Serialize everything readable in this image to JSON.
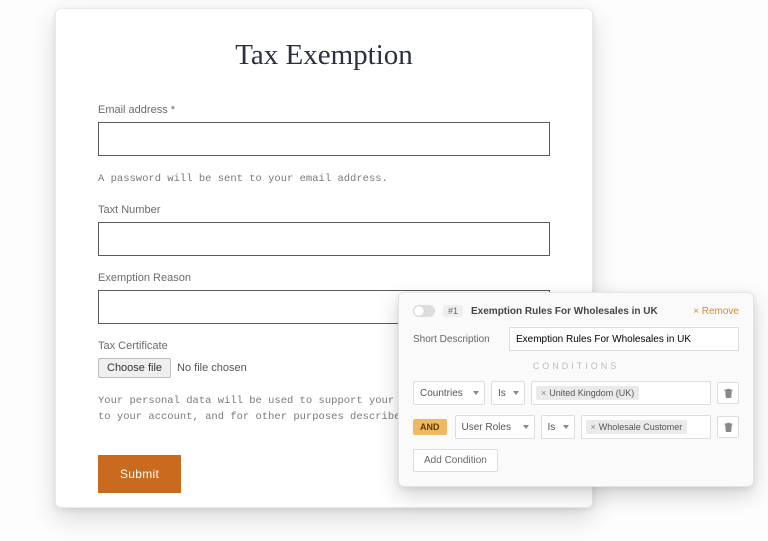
{
  "form": {
    "title": "Tax Exemption",
    "email_label": "Email address *",
    "hint1": "A password will be sent to your email address.",
    "tax_number_label": "Taxt Number",
    "reason_label": "Exemption Reason",
    "cert_label": "Tax Certificate",
    "choose_file": "Choose file",
    "no_file": "No file chosen",
    "privacy": "Your personal data will be used to support your experience throu access to your account, and for other purposes described in our",
    "submit": "Submit"
  },
  "rules": {
    "number": "#1",
    "title": "Exemption Rules For Wholesales in UK",
    "remove": "Remove",
    "short_desc_label": "Short Description",
    "short_desc_value": "Exemption Rules For Wholesales in UK",
    "conditions_heading": "CONDITIONS",
    "cond1_field": "Countries",
    "cond1_op": "Is",
    "cond1_chip": "United Kingdom (UK)",
    "and": "AND",
    "cond2_field": "User Roles",
    "cond2_op": "Is",
    "cond2_chip": "Wholesale Customer",
    "add_condition": "Add Condition"
  }
}
